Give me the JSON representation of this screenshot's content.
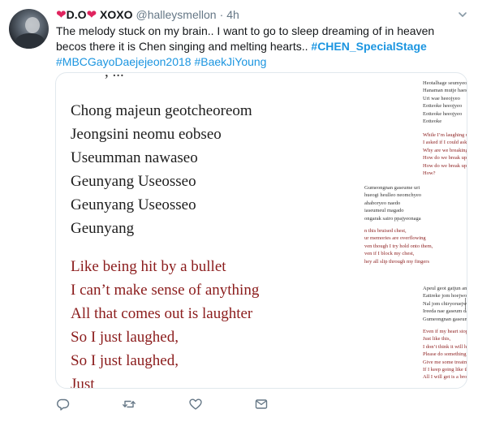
{
  "tweet": {
    "display_name": "D.O",
    "display_name_suffix": "XOXO",
    "handle": "@halleysmellon",
    "separator": "·",
    "time": "4h",
    "text_plain": "The melody stuck on my brain.. I want to go to sleep dreaming of in heaven becos there it is Chen singing and melting hearts.. ",
    "hashtags": [
      "#CHEN_SpecialStage",
      "#MBCGayoDaejejeon2018",
      "#BaekJiYoung"
    ]
  },
  "media": {
    "left_cut_line": ", ... ",
    "left_lyrics_black": [
      "Chong majeun geotcheoreom",
      "Jeongsini neomu eobseo",
      "Useumman nawaseo",
      "Geunyang Useosseo",
      "Geunyang Useosseo",
      "Geunyang"
    ],
    "left_lyrics_red": [
      "Like being hit by a bullet",
      "I can’t make sense of anything",
      "All that comes out is laughter",
      "So I just laughed,",
      "So I just laughed,",
      "Just"
    ],
    "right_blocks": [
      {
        "color": "black",
        "lines": [
          "Heotalhage seumyeo",
          "Hanaman mutje haesseo",
          "Uri wae heeojyeo",
          "Eotteoke heeojyeo",
          "Eotteoke heeojyeo",
          "Eotteoke"
        ]
      },
      {
        "color": "red",
        "lines": [
          "While I’m laughing until I collapse",
          "I asked if I could ask one thing",
          "Why are we breaking up?",
          "How do we break up?",
          "How do we break up?",
          "How?"
        ]
      },
      {
        "color": "black",
        "lines": [
          "Gumeongnan gaseume uri",
          "hueogi heulleo neomchyeo",
          "ahaboryeo naedo",
          "iaseumeul magado",
          "ongarak sairo ppajyeonaga"
        ]
      },
      {
        "color": "red",
        "lines": [
          "n this bruised chest,",
          "ur memories are overflowing",
          "ven though I try hold onto them,",
          "ven if I block my chest,",
          "hey all slip through my fingers"
        ]
      },
      {
        "color": "black",
        "lines": [
          "Apeul geot gatjun anha",
          "Eattreke jom hoejwo",
          "Nal jom chiryoruejwo",
          "Ireeda nae gaseum da manggajyeo",
          "Gumeongnan gaseumi"
        ]
      },
      {
        "color": "red",
        "lines": [
          "Even if my heart stops,",
          "Just like this,",
          "I don’t think it will hurt,",
          "Please do something",
          "Give me some treatment",
          "If I keep going like this,",
          "All I will get is a broken heart"
        ]
      }
    ]
  },
  "icons": {
    "heart": "red-heart-icon",
    "caret": "chevron-down-icon",
    "reply": "reply-icon",
    "retweet": "retweet-icon",
    "like": "like-heart-icon",
    "dm": "envelope-icon"
  },
  "colors": {
    "link": "#1b95e0",
    "muted": "#657786",
    "heart": "#e0245e",
    "lyric_red": "#8b1c1c"
  }
}
